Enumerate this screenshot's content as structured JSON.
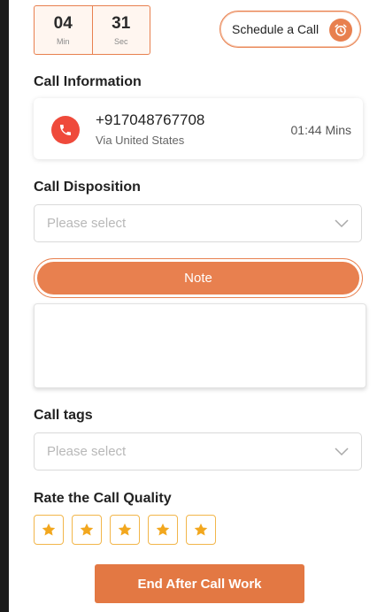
{
  "timer": {
    "minutes": "04",
    "minutes_label": "Min",
    "seconds": "31",
    "seconds_label": "Sec"
  },
  "schedule": {
    "label": "Schedule a Call",
    "icon": "alarm-clock-icon"
  },
  "call_info": {
    "title": "Call Information",
    "number": "+917048767708",
    "via": "Via United States",
    "duration": "01:44 Mins",
    "icon": "phone-icon",
    "badge_color": "#ef4a3b"
  },
  "disposition": {
    "title": "Call Disposition",
    "placeholder": "Please select"
  },
  "note": {
    "label": "Note",
    "value": ""
  },
  "tags": {
    "title": "Call tags",
    "placeholder": "Please select"
  },
  "rating": {
    "title": "Rate the Call Quality",
    "stars": 5,
    "selected": 0
  },
  "end_button": {
    "label": "End After Call Work"
  },
  "colors": {
    "accent": "#e8804f",
    "star": "#f2a71e"
  }
}
